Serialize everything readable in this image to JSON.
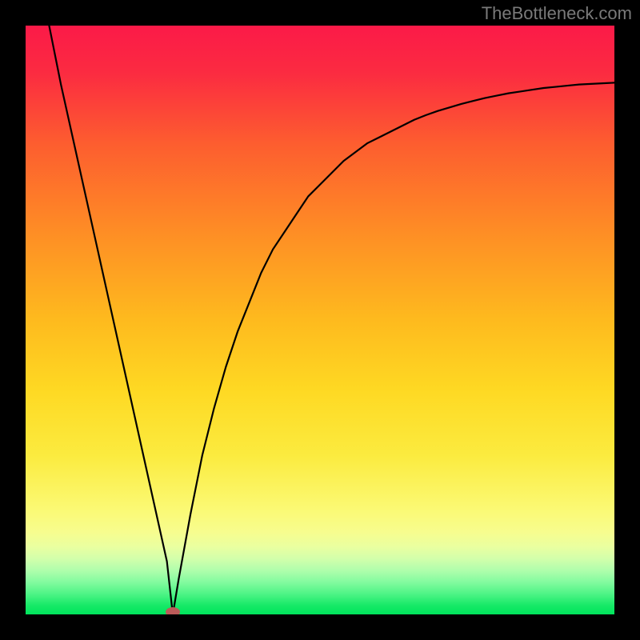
{
  "watermark": "TheBottleneck.com",
  "chart_data": {
    "type": "line",
    "title": "",
    "xlabel": "",
    "ylabel": "",
    "xlim": [
      0,
      100
    ],
    "ylim": [
      0,
      100
    ],
    "grid": false,
    "legend": false,
    "marker": {
      "x": 25,
      "y": 0,
      "color": "#bb5b59"
    },
    "series": [
      {
        "name": "curve",
        "x": [
          4,
          6,
          8,
          10,
          12,
          14,
          16,
          18,
          20,
          22,
          24,
          25,
          26,
          28,
          30,
          32,
          34,
          36,
          38,
          40,
          42,
          44,
          46,
          48,
          50,
          52,
          54,
          56,
          58,
          60,
          62,
          64,
          66,
          68,
          70,
          72,
          74,
          76,
          78,
          80,
          82,
          84,
          86,
          88,
          90,
          92,
          94,
          96,
          98,
          100
        ],
        "y": [
          100,
          90,
          81,
          72,
          63,
          54,
          45,
          36,
          27,
          18,
          9,
          0,
          6,
          17,
          27,
          35,
          42,
          48,
          53,
          58,
          62,
          65,
          68,
          71,
          73,
          75,
          77,
          78.5,
          80,
          81,
          82,
          83,
          84,
          84.8,
          85.5,
          86.1,
          86.7,
          87.2,
          87.7,
          88.1,
          88.5,
          88.8,
          89.1,
          89.4,
          89.6,
          89.8,
          90,
          90.1,
          90.2,
          90.3
        ]
      }
    ],
    "background_gradient": {
      "top": "#fb1a48",
      "mid": "#fec728",
      "low": "#fbf973",
      "bottom": "#00e45c"
    }
  }
}
